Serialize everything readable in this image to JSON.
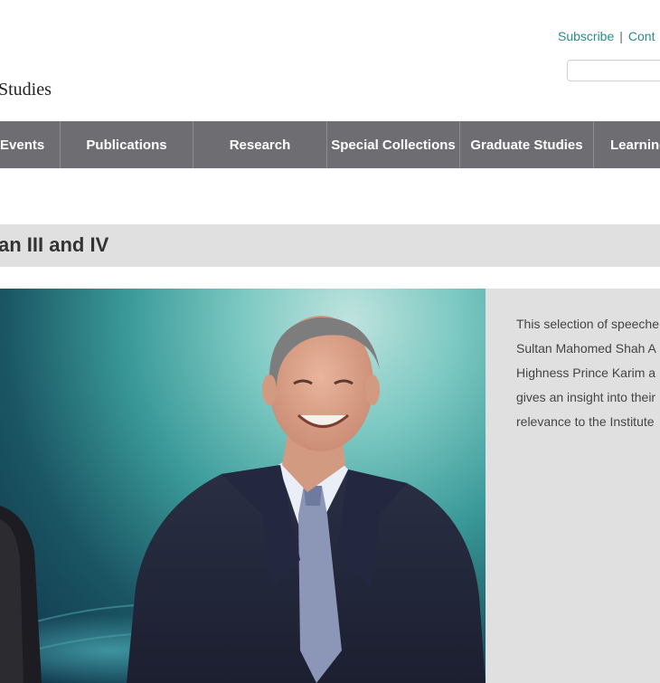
{
  "header": {
    "links": [
      {
        "label": "Subscribe"
      },
      {
        "label": "Cont"
      }
    ],
    "separator": "|",
    "site_name_fragment": "Studies",
    "search": {
      "value": "",
      "placeholder": ""
    }
  },
  "nav": {
    "items": [
      {
        "label": "Events"
      },
      {
        "label": "Publications"
      },
      {
        "label": "Research"
      },
      {
        "label": "Special Collections"
      },
      {
        "label": "Graduate Studies"
      },
      {
        "label": "Learning"
      }
    ]
  },
  "page": {
    "title": "an III and IV"
  },
  "description": {
    "lines": [
      "This selection of speeche",
      "Sultan Mahomed Shah A",
      "Highness Prince Karim a",
      "gives an insight into their",
      "relevance to the Institute"
    ]
  },
  "colors": {
    "link": "#2a8c8c",
    "nav_bg": "#6e6d72",
    "band_bg": "#e0e0e0"
  }
}
